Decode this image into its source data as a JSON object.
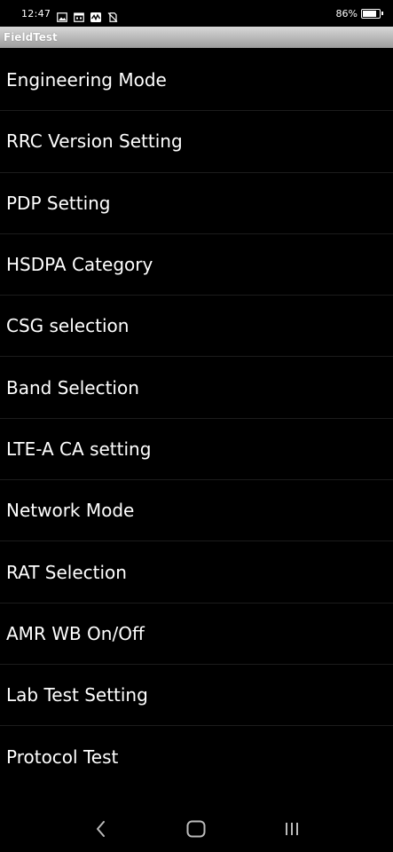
{
  "status_bar": {
    "time": "12:47",
    "icons": [
      "image-icon",
      "calendar-icon",
      "activity-icon",
      "no-sim-icon"
    ],
    "battery_percent_text": "86%",
    "battery_level": 0.86
  },
  "title_bar": {
    "title": "FieldTest"
  },
  "menu": {
    "items": [
      {
        "label": "Engineering Mode"
      },
      {
        "label": "RRC Version Setting"
      },
      {
        "label": "PDP Setting"
      },
      {
        "label": "HSDPA Category"
      },
      {
        "label": "CSG selection"
      },
      {
        "label": "Band Selection"
      },
      {
        "label": "LTE-A CA setting"
      },
      {
        "label": "Network Mode"
      },
      {
        "label": "RAT Selection"
      },
      {
        "label": "AMR WB On/Off"
      },
      {
        "label": "Lab Test Setting"
      },
      {
        "label": "Protocol Test"
      }
    ]
  },
  "nav_bar": {
    "buttons": [
      "back-icon",
      "home-icon",
      "recents-icon"
    ]
  }
}
